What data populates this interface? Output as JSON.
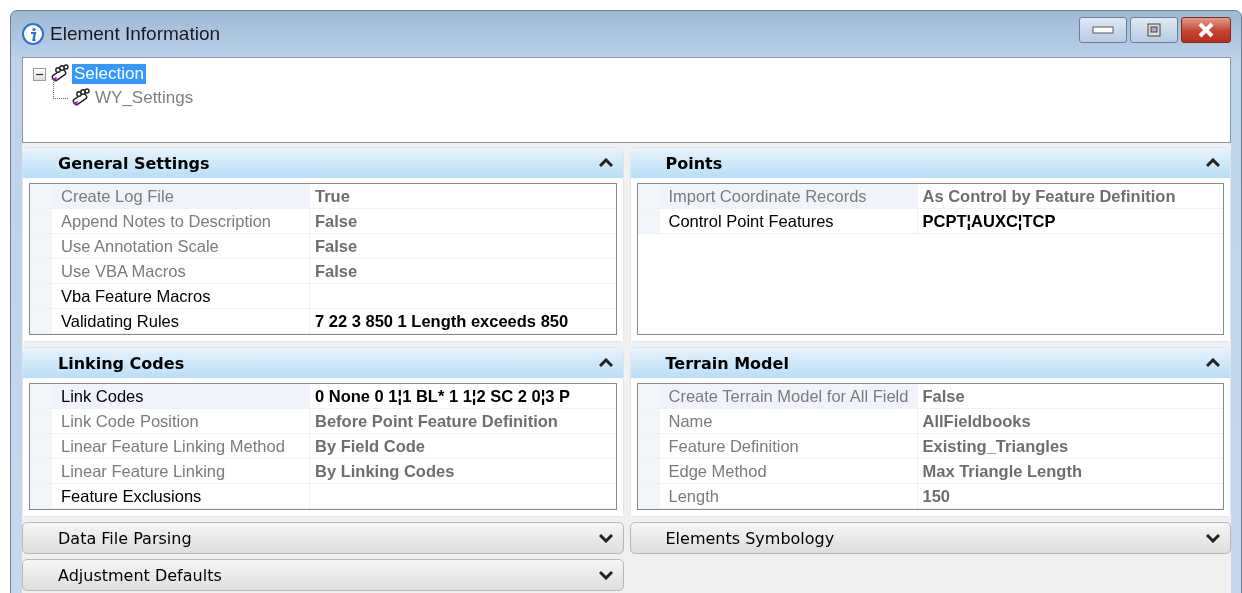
{
  "window": {
    "title": "Element Information"
  },
  "tree": [
    {
      "label": "Selection",
      "selected": true,
      "expanded": true,
      "children": [
        {
          "label": "WY_Settings",
          "selected": false
        }
      ]
    }
  ],
  "columns": [
    [
      {
        "title": "General Settings",
        "expanded": true,
        "rows": [
          {
            "label": "Create Log File",
            "value": "True",
            "disabled": true,
            "selected": true
          },
          {
            "label": "Append Notes to Description",
            "value": "False",
            "disabled": true,
            "selected": false
          },
          {
            "label": "Use Annotation Scale",
            "value": "False",
            "disabled": true,
            "selected": false
          },
          {
            "label": "Use VBA Macros",
            "value": "False",
            "disabled": true,
            "selected": false
          },
          {
            "label": "Vba Feature Macros",
            "disabled": false,
            "selected": false
          },
          {
            "label": "Validating Rules",
            "value": "7 22 3 850 1 Length exceeds 850",
            "disabled": false,
            "selected": false
          }
        ]
      },
      {
        "title": "Linking Codes",
        "expanded": true,
        "rows": [
          {
            "label": "Link Codes",
            "value": "0 None 0 1¦1 BL* 1 1¦2 SC 2 0¦3 P",
            "disabled": false,
            "selected": true
          },
          {
            "label": "Link Code Position",
            "value": "Before Point Feature Definition",
            "disabled": true,
            "selected": false
          },
          {
            "label": "Linear Feature Linking Method",
            "value": "By Field Code",
            "disabled": true,
            "selected": false
          },
          {
            "label": "Linear Feature Linking",
            "value": "By Linking Codes",
            "disabled": true,
            "selected": false
          },
          {
            "label": "Feature Exclusions",
            "disabled": false,
            "selected": false
          }
        ]
      },
      {
        "title": "Data File Parsing",
        "expanded": false
      },
      {
        "title": "Adjustment Defaults",
        "expanded": false
      }
    ],
    [
      {
        "title": "Points",
        "expanded": true,
        "rows": [
          {
            "label": "Import Coordinate Records",
            "value": "As Control by Feature Definition",
            "disabled": true,
            "selected": true
          },
          {
            "label": "Control Point Features",
            "value": "PCPT¦AUXC¦TCP",
            "disabled": false,
            "selected": false
          }
        ]
      },
      {
        "title": "Terrain Model",
        "expanded": true,
        "rows": [
          {
            "label": "Create Terrain Model for All Field",
            "value": "False",
            "disabled": true,
            "selected": true
          },
          {
            "label": "Name",
            "value": "AllFieldbooks",
            "disabled": true,
            "selected": false
          },
          {
            "label": "Feature Definition",
            "value": "Existing_Triangles",
            "disabled": true,
            "selected": false
          },
          {
            "label": "Edge Method",
            "value": "Max Triangle Length",
            "disabled": true,
            "selected": false
          },
          {
            "label": "Length",
            "value": "150",
            "disabled": true,
            "selected": false
          }
        ]
      },
      {
        "title": "Elements Symbology",
        "expanded": false
      }
    ]
  ]
}
